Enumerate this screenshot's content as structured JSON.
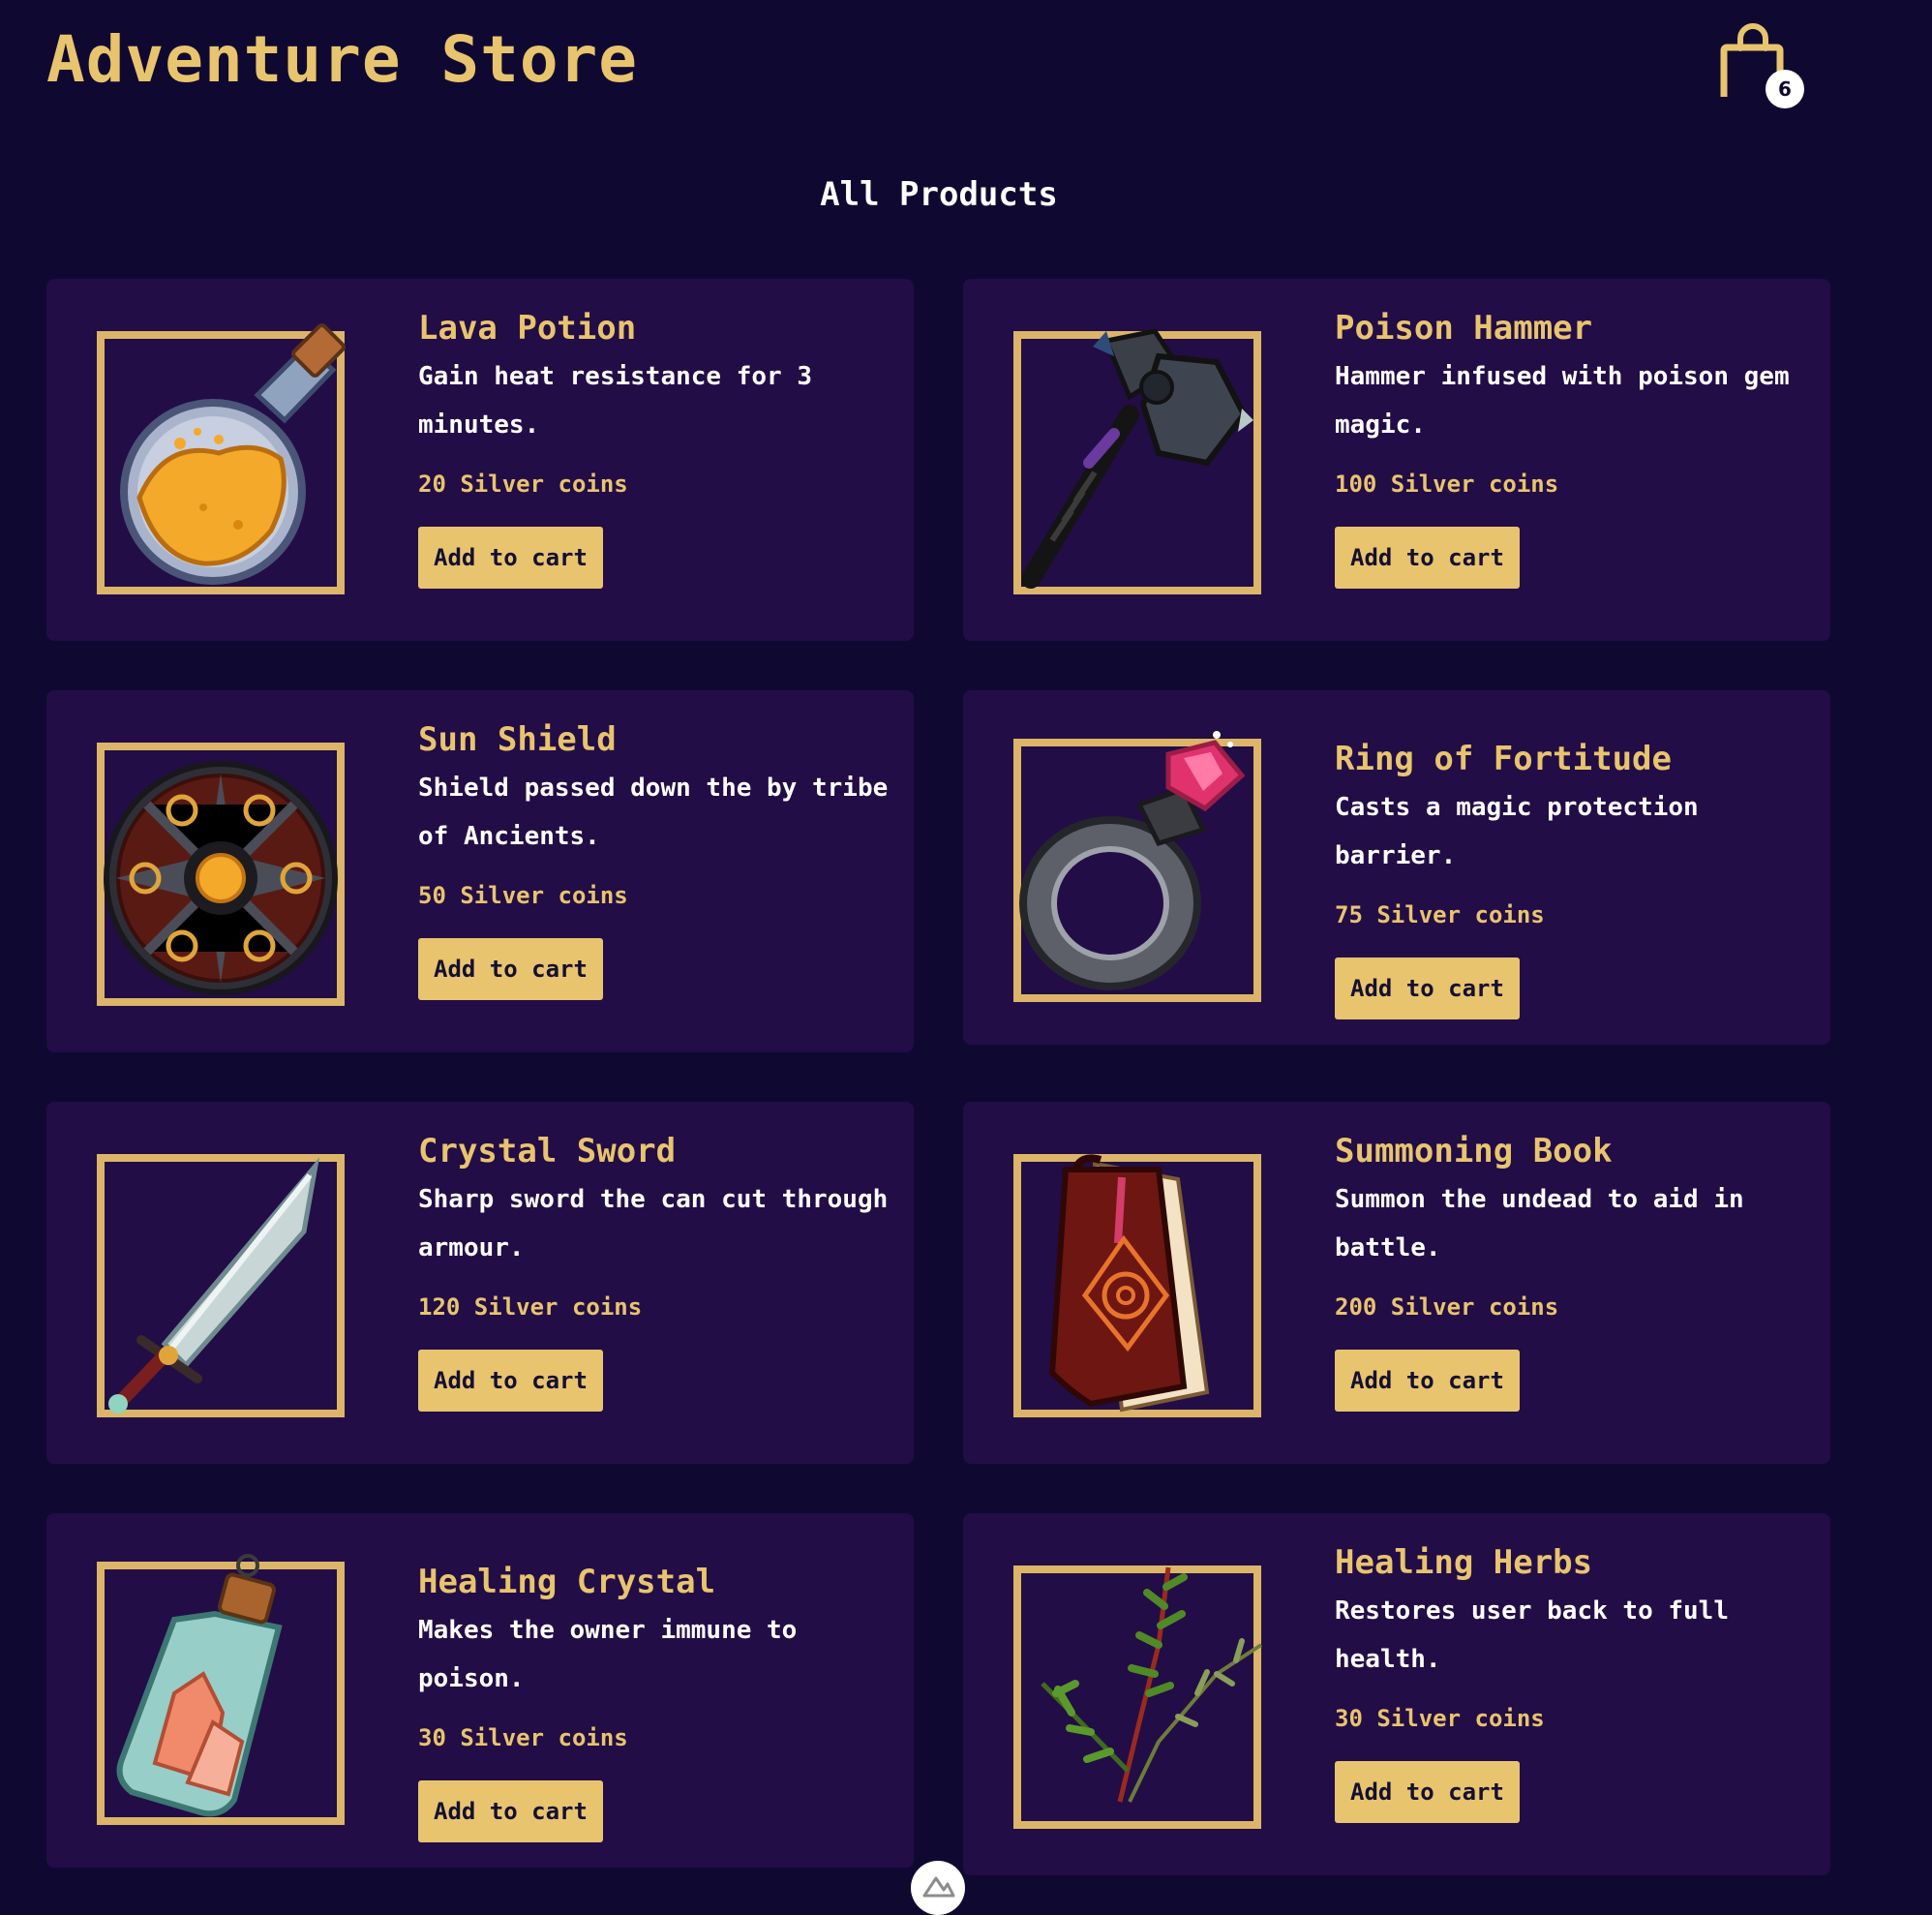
{
  "header": {
    "store_title": "Adventure Store",
    "cart_icon": "shopping-bag-icon",
    "cart_count": "6"
  },
  "main": {
    "heading": "All Products",
    "products": [
      {
        "name": "Lava Potion",
        "description": "Gain heat resistance for 3 minutes.",
        "price": "20 Silver coins",
        "button_label": "Add to cart",
        "icon": "lava-potion-icon"
      },
      {
        "name": "Poison Hammer",
        "description": "Hammer infused with poison gem magic.",
        "price": "100 Silver coins",
        "button_label": "Add to cart",
        "icon": "poison-hammer-icon"
      },
      {
        "name": "Sun Shield",
        "description": "Shield passed down the by tribe of Ancients.",
        "price": "50 Silver coins",
        "button_label": "Add to cart",
        "icon": "sun-shield-icon"
      },
      {
        "name": "Ring of Fortitude",
        "description": "Casts a magic protection barrier.",
        "price": "75 Silver coins",
        "button_label": "Add to cart",
        "icon": "ring-icon"
      },
      {
        "name": "Crystal Sword",
        "description": "Sharp sword the can cut through armour.",
        "price": "120 Silver coins",
        "button_label": "Add to cart",
        "icon": "crystal-sword-icon"
      },
      {
        "name": "Summoning Book",
        "description": "Summon the undead to aid in battle.",
        "price": "200 Silver coins",
        "button_label": "Add to cart",
        "icon": "summoning-book-icon"
      },
      {
        "name": "Healing Crystal",
        "description": "Makes the owner immune to poison.",
        "price": "30 Silver coins",
        "button_label": "Add to cart",
        "icon": "healing-crystal-icon"
      },
      {
        "name": "Healing Herbs",
        "description": "Restores user back to full health.",
        "price": "30 Silver coins",
        "button_label": "Add to cart",
        "icon": "healing-herbs-icon"
      }
    ]
  },
  "footer": {
    "scroll_icon": "mountain-logo-icon"
  },
  "colors": {
    "background": "#0f0932",
    "card": "#220d47",
    "accent": "#e8c46e",
    "frame": "#dcb569",
    "text": "#ffffff"
  }
}
